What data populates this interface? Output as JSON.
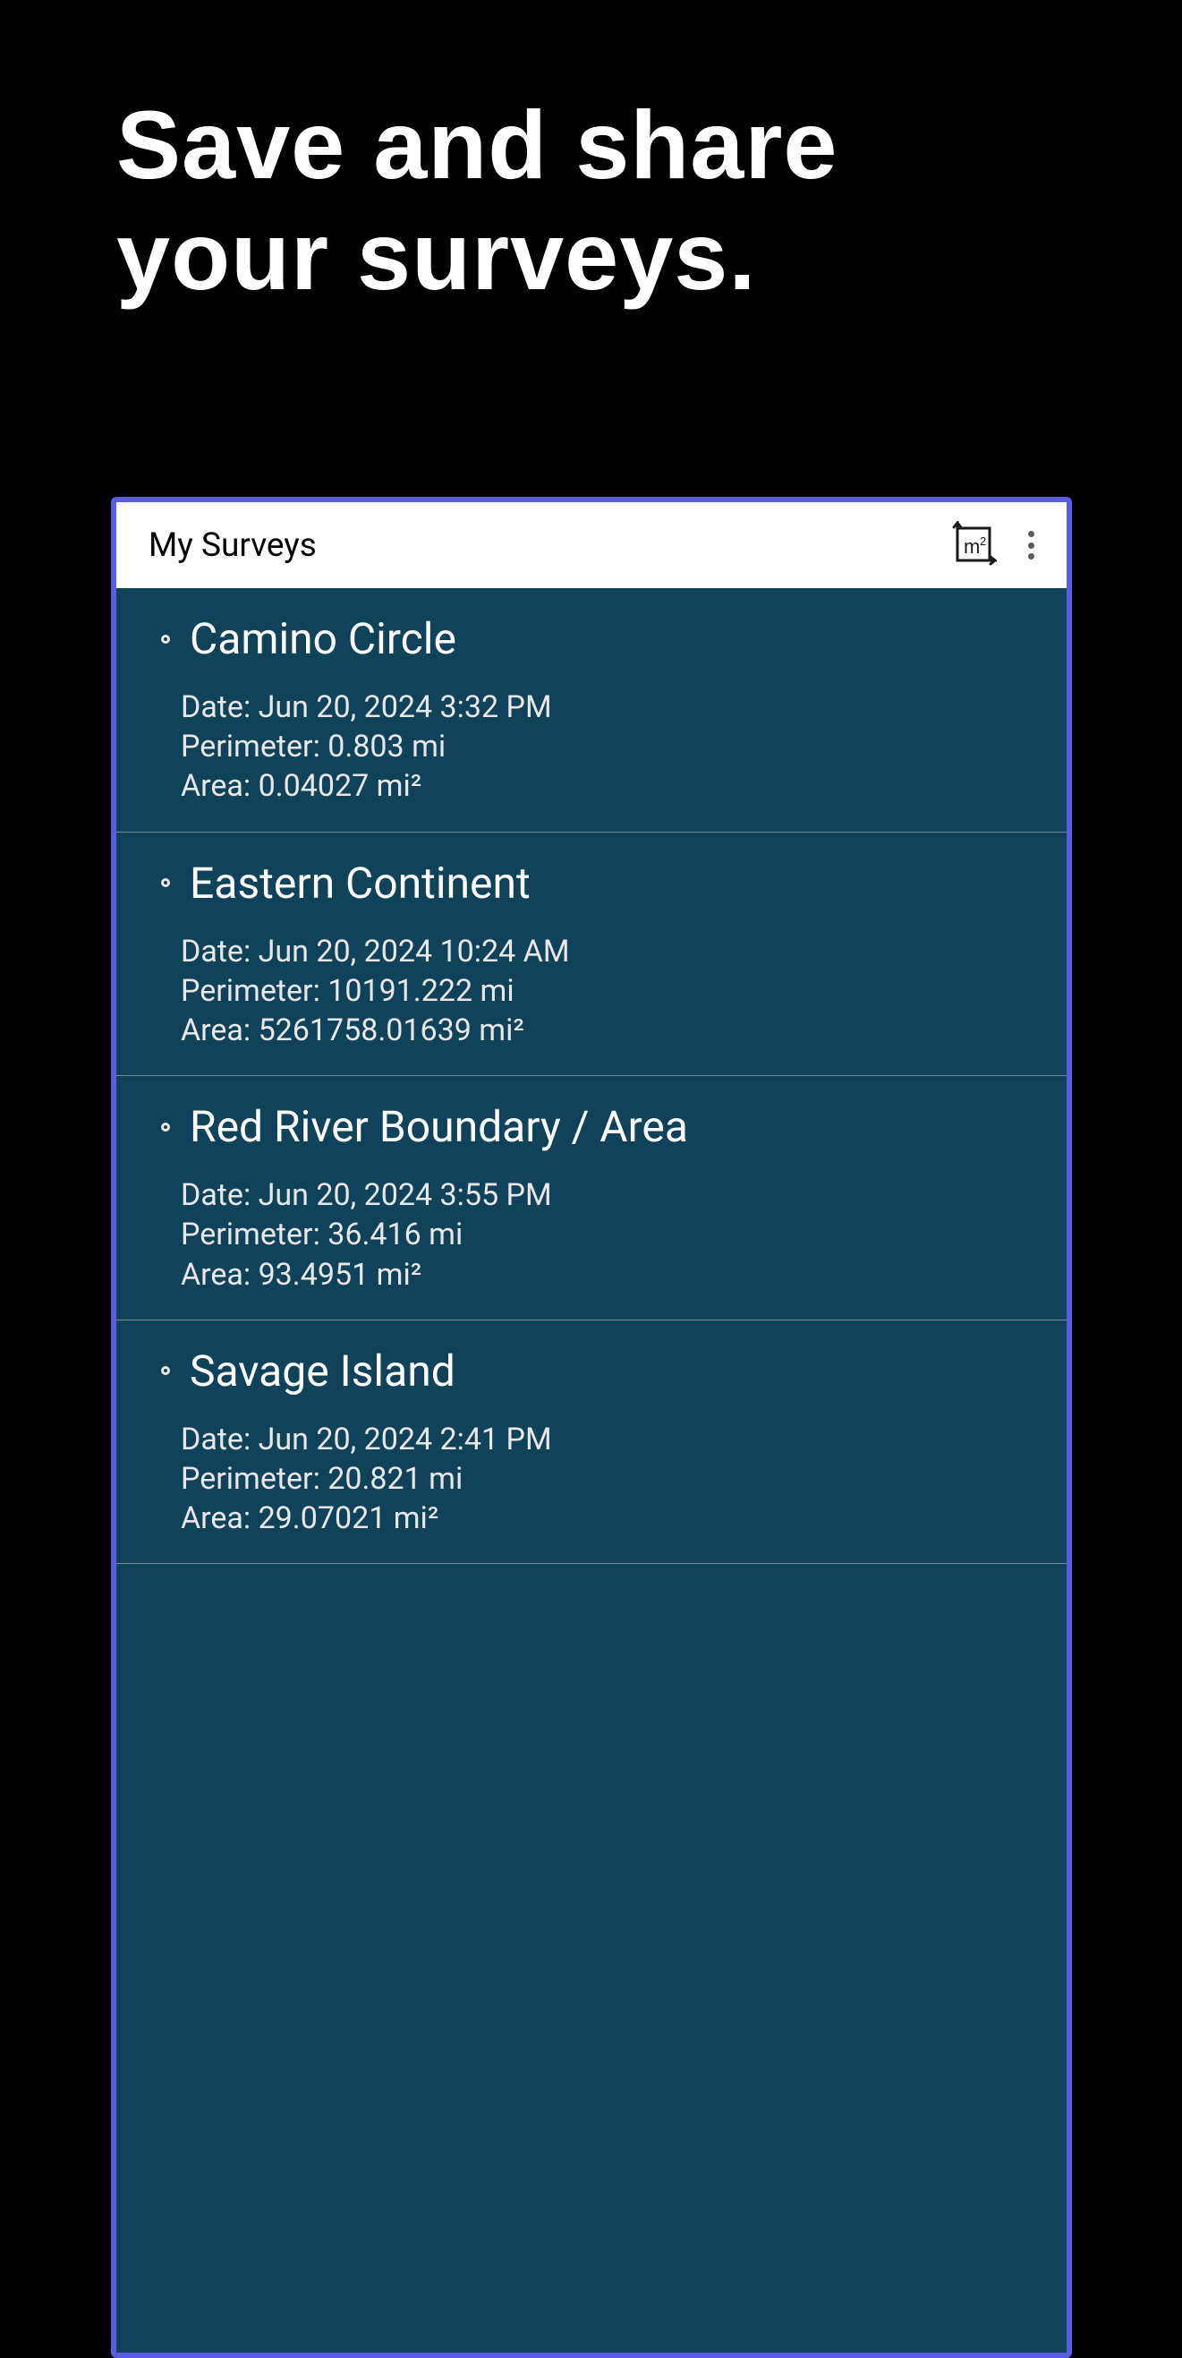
{
  "pageTitle": "Save and share your surveys.",
  "appHeader": {
    "title": "My Surveys"
  },
  "surveys": [
    {
      "name": "Camino Circle",
      "date": "Date: Jun 20, 2024 3:32 PM",
      "perimeter": "Perimeter: 0.803 mi",
      "area": "Area: 0.04027 mi²"
    },
    {
      "name": "Eastern Continent",
      "date": "Date: Jun 20, 2024 10:24 AM",
      "perimeter": "Perimeter: 10191.222 mi",
      "area": "Area: 5261758.01639 mi²"
    },
    {
      "name": "Red River Boundary / Area",
      "date": "Date: Jun 20, 2024 3:55 PM",
      "perimeter": "Perimeter: 36.416 mi",
      "area": "Area: 93.4951 mi²"
    },
    {
      "name": "Savage Island",
      "date": "Date: Jun 20, 2024 2:41 PM",
      "perimeter": "Perimeter: 20.821 mi",
      "area": "Area: 29.07021 mi²"
    }
  ]
}
